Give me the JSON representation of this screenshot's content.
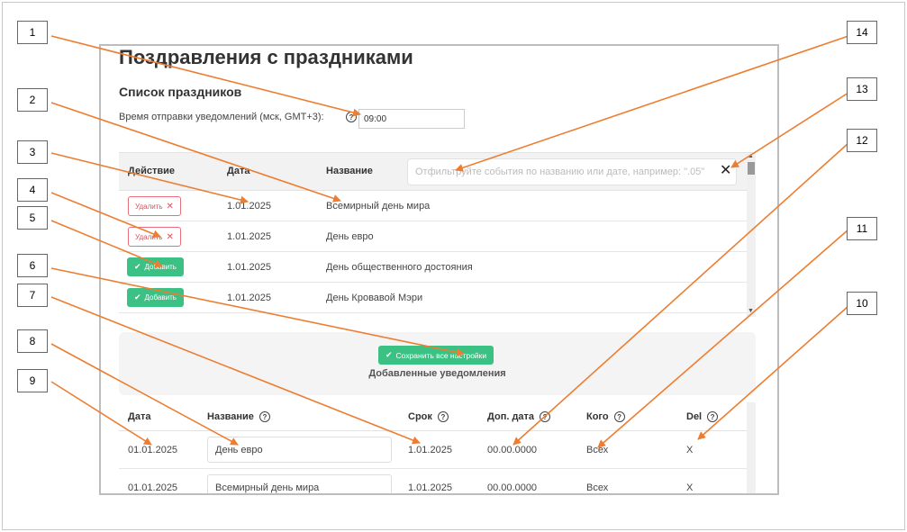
{
  "page": {
    "title": "Поздравления с праздниками",
    "section_title": "Список праздников",
    "time_label": "Время отправки уведомлений (мск, GMT+3):",
    "time_value": "09:00"
  },
  "holidays": {
    "columns": {
      "action": "Действие",
      "date": "Дата",
      "name": "Название"
    },
    "filter_placeholder": "Отфильтруйте события по названию или дате, например: \".05\"",
    "delete_label": "Удалить",
    "add_label": "Добавить",
    "rows": [
      {
        "action": "delete",
        "date": "1.01.2025",
        "name": "Всемирный день мира"
      },
      {
        "action": "delete",
        "date": "1.01.2025",
        "name": "День евро"
      },
      {
        "action": "add",
        "date": "1.01.2025",
        "name": "День общественного достояния"
      },
      {
        "action": "add",
        "date": "1.01.2025",
        "name": "День Кровавой Мэри"
      }
    ]
  },
  "save": {
    "button_label": "Сохранить все настройки",
    "caption": "Добавленные уведомления"
  },
  "notifications": {
    "columns": {
      "date": "Дата",
      "name": "Название",
      "term": "Срок",
      "extra_date": "Доп. дата",
      "who": "Кого",
      "del": "Del"
    },
    "rows": [
      {
        "date": "01.01.2025",
        "name": "День евро",
        "term": "1.01.2025",
        "extra_date": "00.00.0000",
        "who": "Всех",
        "del": "X"
      },
      {
        "date": "01.01.2025",
        "name": "Всемирный день мира",
        "term": "1.01.2025",
        "extra_date": "00.00.0000",
        "who": "Всех",
        "del": "X"
      }
    ]
  },
  "callouts": [
    "1",
    "2",
    "3",
    "4",
    "5",
    "6",
    "7",
    "8",
    "9",
    "10",
    "11",
    "12",
    "13",
    "14"
  ],
  "colors": {
    "accent_green": "#3cc184",
    "delete_red": "#e05060",
    "callout_arrow": "#ed7d31"
  }
}
